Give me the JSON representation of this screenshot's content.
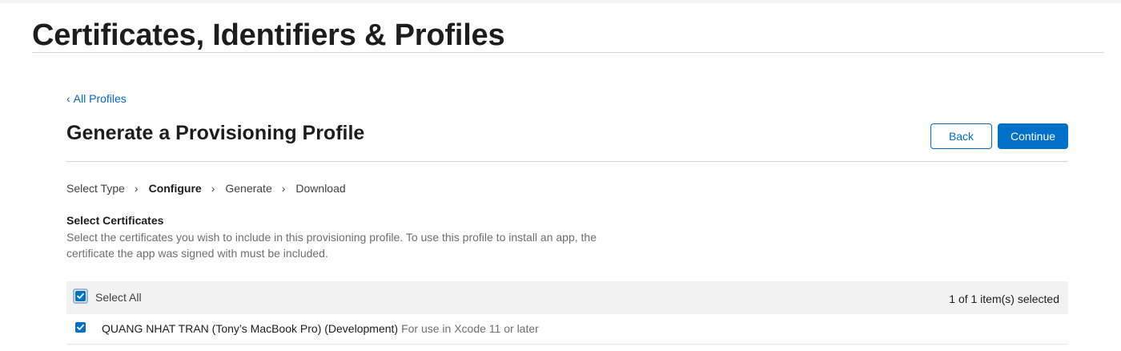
{
  "page": {
    "title": "Certificates, Identifiers & Profiles"
  },
  "nav": {
    "back_link_label": "All Profiles",
    "back_link_chevron": "‹"
  },
  "header": {
    "heading": "Generate a Provisioning Profile",
    "back_button": "Back",
    "continue_button": "Continue"
  },
  "steps": [
    {
      "label": "Select Type",
      "active": false
    },
    {
      "label": "Configure",
      "active": true
    },
    {
      "label": "Generate",
      "active": false
    },
    {
      "label": "Download",
      "active": false
    }
  ],
  "step_separator": "›",
  "certificates": {
    "heading": "Select Certificates",
    "description": "Select the certificates you wish to include in this provisioning profile. To use this profile to install an app, the certificate the app was signed with must be included.",
    "select_all_label": "Select All",
    "select_all_checked": true,
    "selected_count": "1 of 1 item(s) selected",
    "items": [
      {
        "name": "QUANG NHAT TRAN (Tony’s MacBook Pro) (Development)",
        "note": "For use in Xcode 11 or later",
        "checked": true
      }
    ]
  },
  "colors": {
    "accent": "#0070c9",
    "link": "#0066cc",
    "header_row_bg": "#f2f2f2",
    "rule": "#d2d2d7"
  },
  "icons": {
    "checkbox": "checkmark-icon",
    "back": "chevron-left-icon",
    "step_separator": "chevron-right-icon"
  }
}
